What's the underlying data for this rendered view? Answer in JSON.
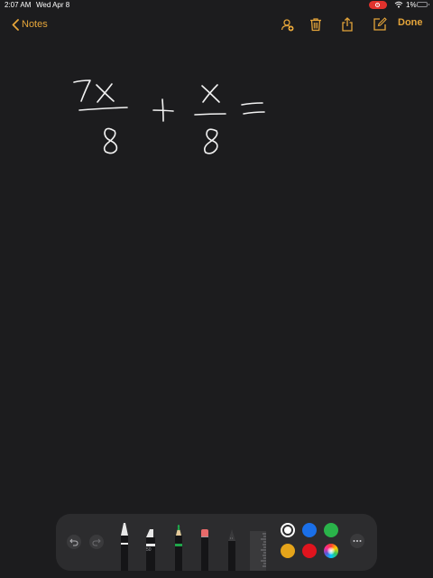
{
  "status_bar": {
    "time": "2:07 AM",
    "date": "Wed Apr 8",
    "battery": "1%"
  },
  "nav": {
    "back_label": "Notes",
    "done_label": "Done",
    "accent_color": "#e5a53a"
  },
  "toolbar": {
    "pen_size_label": "50",
    "palette": {
      "white": "#ffffff",
      "blue": "#1a6fe8",
      "green": "#2ab34a",
      "yellow": "#e5a41a",
      "red": "#e0141e"
    },
    "selected_color": "white"
  },
  "icons": [
    "chevron-left-icon",
    "add-person-icon",
    "trash-icon",
    "share-icon",
    "compose-icon",
    "undo-icon",
    "redo-icon",
    "more-icon",
    "wifi-icon",
    "battery-icon",
    "recording-icon"
  ]
}
